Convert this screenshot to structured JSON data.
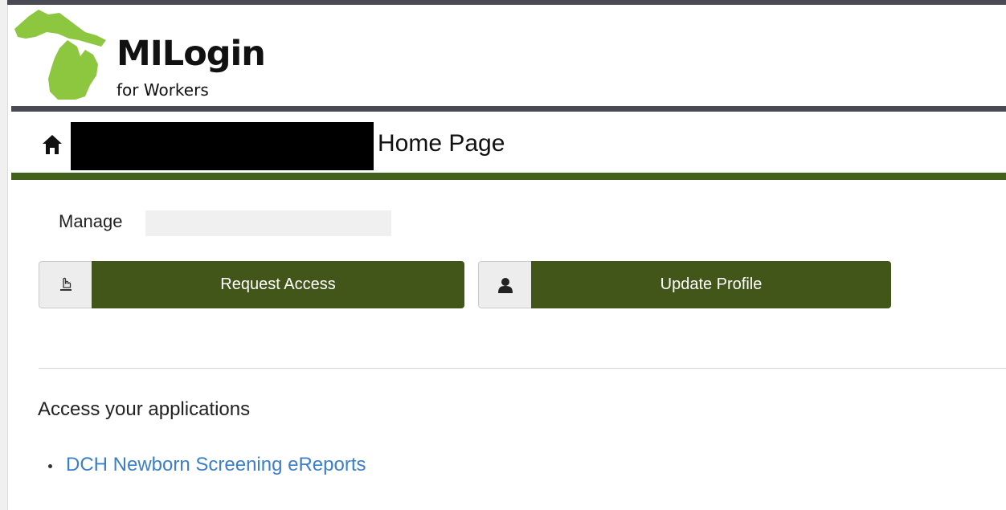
{
  "header": {
    "logo_title": "MILogin",
    "logo_subtitle": "for Workers"
  },
  "breadcrumb": {
    "home_icon": "home-icon",
    "page_title": "Home Page"
  },
  "manage": {
    "label": "Manage"
  },
  "actions": [
    {
      "label": "Request Access",
      "icon": "hand-pointer-icon"
    },
    {
      "label": "Update Profile",
      "icon": "user-icon"
    }
  ],
  "applications": {
    "heading": "Access your applications",
    "items": [
      {
        "label": "DCH Newborn Screening eReports"
      }
    ]
  },
  "colors": {
    "top_bar": "#4a4a52",
    "logo_green": "#8dc63f",
    "accent_green": "#42621b",
    "button_green": "#42561a",
    "link_blue": "#3a7fc8"
  }
}
